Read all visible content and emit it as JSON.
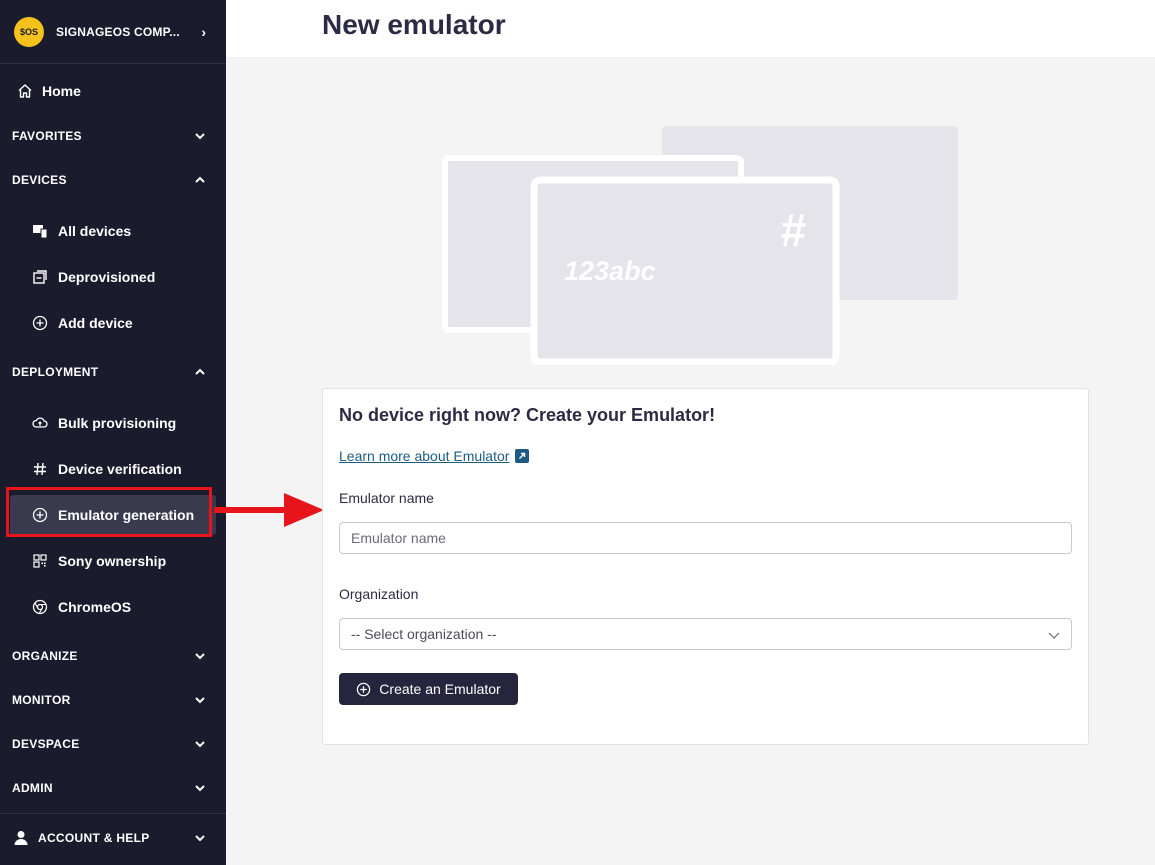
{
  "sidebar": {
    "company": {
      "logo_text": "$OS",
      "name": "SIGNAGEOS COMP...",
      "chevron_icon": "chevron-right-icon"
    },
    "home": {
      "label": "Home",
      "icon": "home-icon"
    },
    "sections": {
      "favorites": "FAVORITES",
      "devices": "DEVICES",
      "deployment": "DEPLOYMENT",
      "organize": "ORGANIZE",
      "monitor": "MONITOR",
      "devspace": "DEVSPACE",
      "admin": "ADMIN"
    },
    "devices_items": [
      {
        "label": "All devices",
        "icon": "devices-icon"
      },
      {
        "label": "Deprovisioned",
        "icon": "deprovisioned-icon"
      },
      {
        "label": "Add device",
        "icon": "plus-circle-icon"
      }
    ],
    "deployment_items": [
      {
        "label": "Bulk provisioning",
        "icon": "cloud-icon"
      },
      {
        "label": "Device verification",
        "icon": "hash-icon"
      },
      {
        "label": "Emulator generation",
        "icon": "plus-circle-icon"
      },
      {
        "label": "Sony ownership",
        "icon": "qr-icon"
      },
      {
        "label": "ChromeOS",
        "icon": "chrome-icon"
      }
    ],
    "account": {
      "label": "ACCOUNT & HELP",
      "icon": "user-icon"
    }
  },
  "header": {
    "title": "New emulator"
  },
  "illustration": {
    "hash_text": "#",
    "code_text": "123abc"
  },
  "card": {
    "title": "No device right now? Create your Emulator!",
    "learn_more": "Learn more about Emulator",
    "emulator_name_label": "Emulator name",
    "emulator_name_placeholder": "Emulator name",
    "emulator_name_value": "",
    "organization_label": "Organization",
    "organization_selected": "-- Select organization --",
    "create_button": "Create an Emulator"
  },
  "colors": {
    "sidebar_bg": "#1b1b2e",
    "accent_yellow": "#f3c21c",
    "highlight_red": "#e8141c",
    "button_bg": "#25253e",
    "link": "#1d5c82"
  }
}
